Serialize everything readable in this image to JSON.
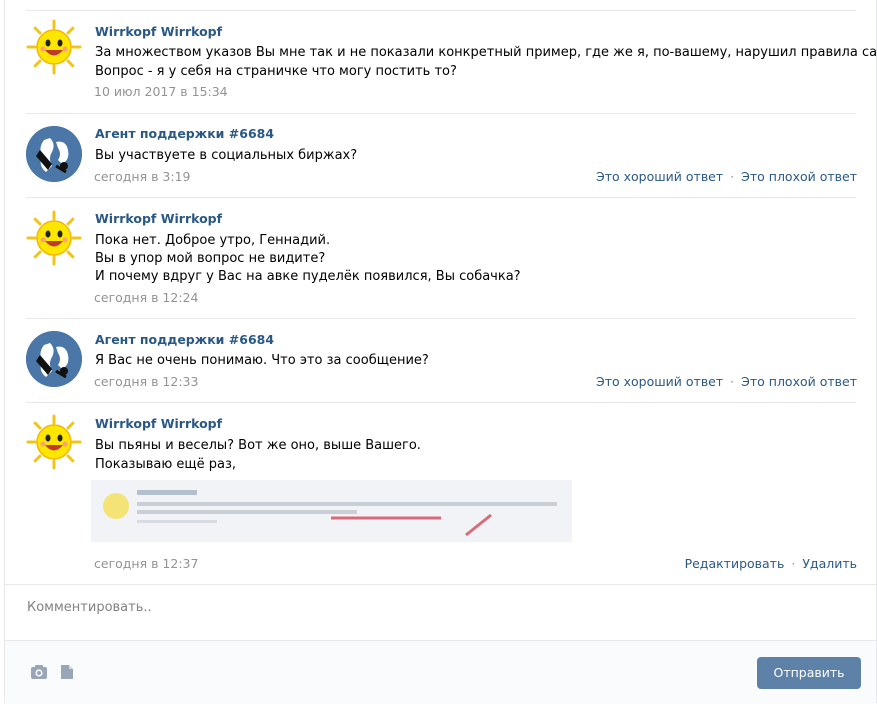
{
  "messages": [
    {
      "author": "Wirrkopf Wirrkopf",
      "lines": [
        "За множеством указов Вы мне так и не показали конкретный пример, где же я, по-вашему, нарушил правила сайта.",
        "Вопрос - я у себя на страничке что могу постить то?"
      ],
      "date": "10 июл 2017 в 15:34"
    },
    {
      "author": "Агент поддержки #6684",
      "lines": [
        "Вы участвуете в социальных биржах?"
      ],
      "date": "сегодня в 3:19",
      "actions": [
        "Это хороший ответ",
        "Это плохой ответ"
      ]
    },
    {
      "author": "Wirrkopf Wirrkopf",
      "lines": [
        "Пока нет. Доброе утро, Геннадий.",
        "Вы в упор мой вопрос не видите?",
        "И почему вдруг у Вас на авке пуделёк появился, Вы собачка?"
      ],
      "date": "сегодня в 12:24"
    },
    {
      "author": "Агент поддержки #6684",
      "lines": [
        "Я Вас не очень понимаю. Что это за сообщение?"
      ],
      "date": "сегодня в 12:33",
      "actions": [
        "Это хороший ответ",
        "Это плохой ответ"
      ]
    },
    {
      "author": "Wirrkopf Wirrkopf",
      "lines": [
        "Вы пьяны и веселы? Вот же оно, выше Вашего.",
        "Показываю ещё раз,"
      ],
      "date": "сегодня в 12:37",
      "actions": [
        "Редактировать",
        "Удалить"
      ]
    }
  ],
  "composer": {
    "placeholder": "Комментировать..",
    "send_label": "Отправить",
    "icons": [
      "camera-icon",
      "document-icon"
    ]
  },
  "colors": {
    "link": "#2a5885",
    "muted": "#939393",
    "button": "#5e81a8",
    "divider": "#e7e8ec"
  }
}
